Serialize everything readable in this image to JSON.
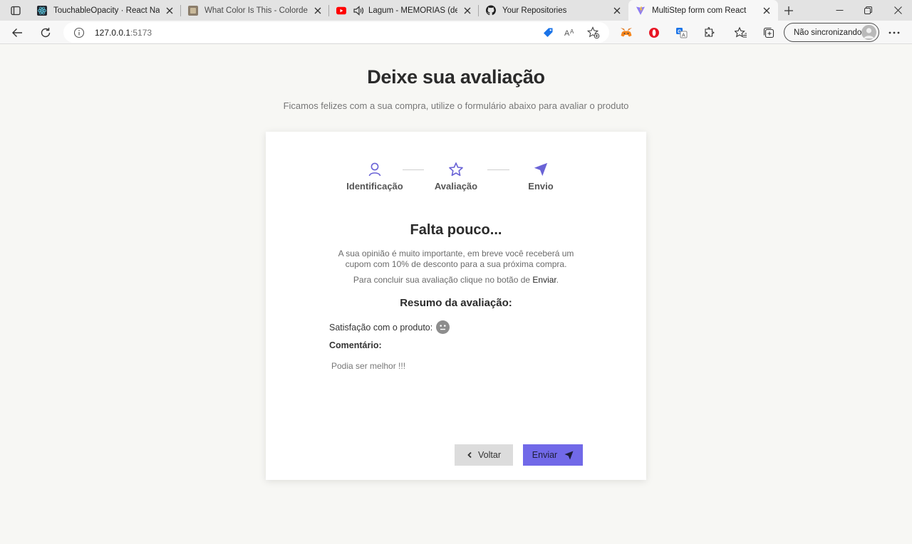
{
  "browser": {
    "tabs": [
      {
        "title": "TouchableOpacity · React Native",
        "favicon": "react-icon"
      },
      {
        "title": "What Color Is This - Colordesigner",
        "favicon": "colordesigner-icon"
      },
      {
        "title": "Lagum - MEMÓRIAS (de onde eu...",
        "favicon": "youtube-icon",
        "audio": "speaker-icon"
      },
      {
        "title": "Your Repositories",
        "favicon": "github-icon"
      },
      {
        "title": "MultiStep form com React",
        "favicon": "vite-icon",
        "active": true
      }
    ],
    "address": {
      "host": "127.0.0.1",
      "port": ":5173"
    },
    "sync_label": "Não sincronizando"
  },
  "page": {
    "title": "Deixe sua avaliação",
    "subtitle": "Ficamos felizes com a sua compra, utilize o formulário abaixo para avaliar o produto"
  },
  "steps": [
    {
      "label": "Identificação",
      "icon": "user-icon"
    },
    {
      "label": "Avaliação",
      "icon": "star-icon"
    },
    {
      "label": "Envio",
      "icon": "send-icon",
      "active": true
    }
  ],
  "summary": {
    "heading": "Falta pouco...",
    "message": "A sua opinião é muito importante, em breve você receberá um cupom com 10% de desconto para a sua próxima compra.",
    "instruction_prefix": "Para concluir sua avaliação clique no botão de ",
    "instruction_button": "Enviar",
    "instruction_suffix": ".",
    "resumo_title": "Resumo da avaliação:",
    "satisfaction_label": "Satisfação com o produto:",
    "satisfaction_icon": "neutral-face-icon",
    "comment_label": "Comentário:",
    "comment_value": "Podia ser melhor !!!"
  },
  "actions": {
    "back": "Voltar",
    "submit": "Enviar"
  },
  "colors": {
    "accent": "#7169e8",
    "page_bg": "#f7f7f4",
    "step_icon": "#6a63d6"
  }
}
